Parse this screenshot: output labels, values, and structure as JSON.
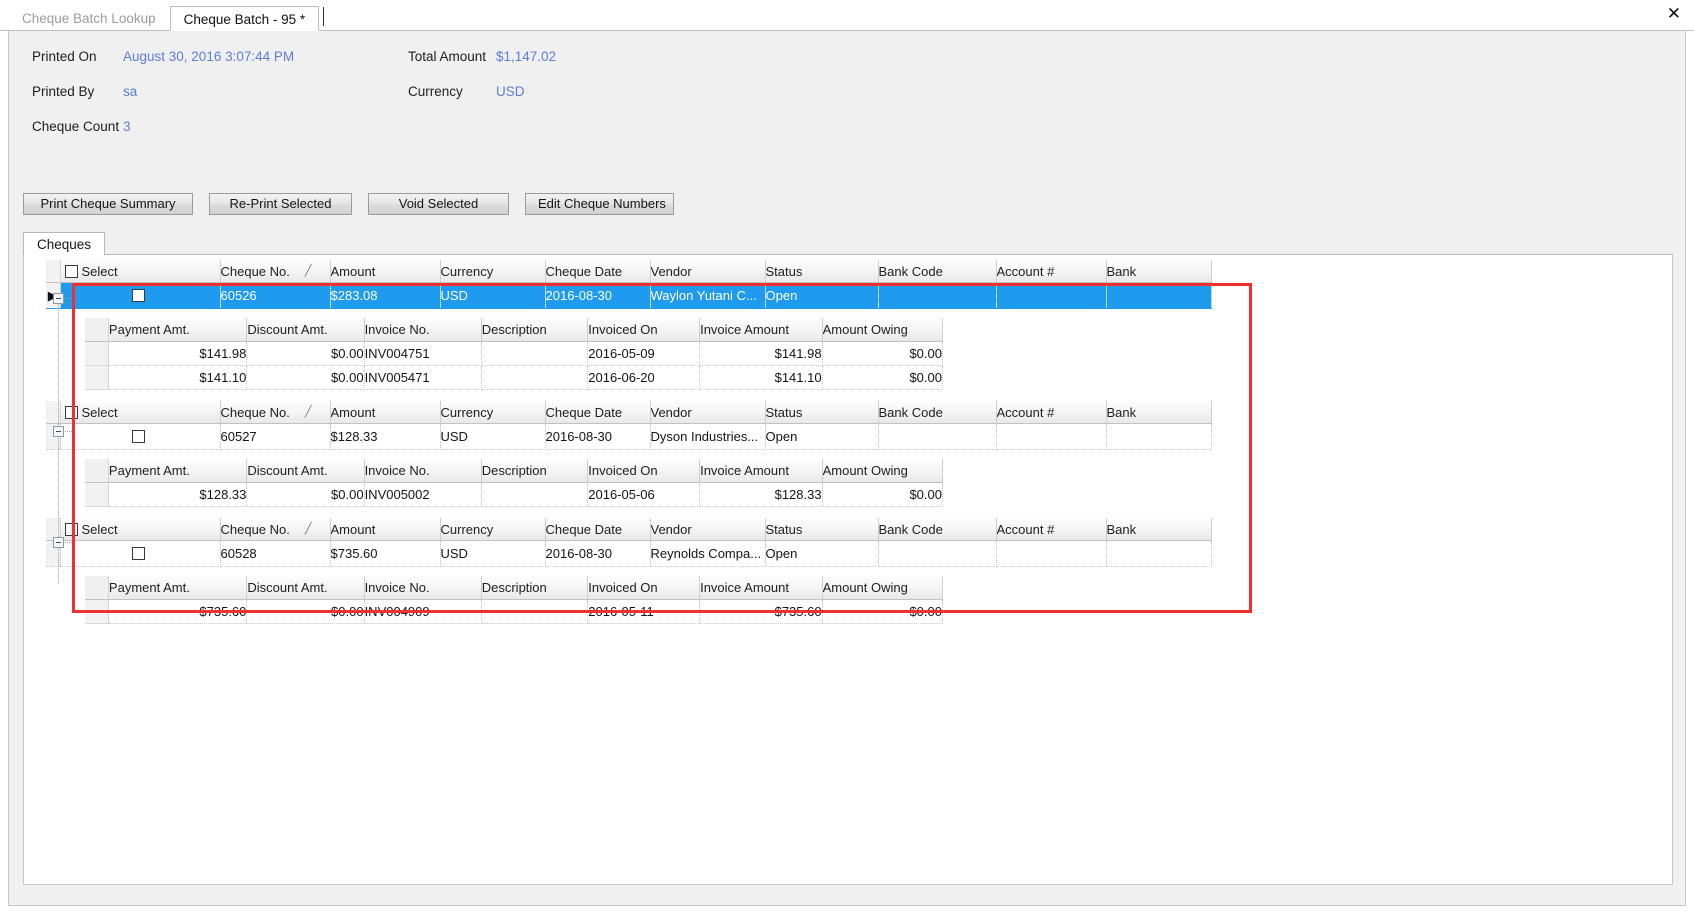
{
  "window": {
    "close_label": "✕",
    "tabs": [
      {
        "label": "Cheque Batch Lookup",
        "active": false
      },
      {
        "label": "Cheque Batch - 95 *",
        "active": true
      }
    ]
  },
  "summary": {
    "printed_on_label": "Printed On",
    "printed_on_value": "August 30, 2016 3:07:44 PM",
    "printed_by_label": "Printed By",
    "printed_by_value": "sa",
    "cheque_count_label": "Cheque Count",
    "cheque_count_value": "3",
    "total_amount_label": "Total Amount",
    "total_amount_value": "$1,147.02",
    "currency_label": "Currency",
    "currency_value": "USD"
  },
  "toolbar": {
    "print_cheque_summary": "Print Cheque Summary",
    "re_print_selected": "Re-Print Selected",
    "void_selected": "Void Selected",
    "edit_cheque_numbers": "Edit Cheque Numbers"
  },
  "inner_tabs": [
    {
      "label": "Cheques",
      "active": true
    }
  ],
  "grid": {
    "columns": [
      "Select",
      "Cheque No.",
      "Amount",
      "Currency",
      "Cheque Date",
      "Vendor",
      "Status",
      "Bank Code",
      "Account #",
      "Bank"
    ],
    "sort_indicator": "╱",
    "detail_columns": [
      "Payment Amt.",
      "Discount Amt.",
      "Invoice No.",
      "Description",
      "Invoiced On",
      "Invoice Amount",
      "Amount Owing"
    ],
    "groups": [
      {
        "selected": true,
        "row_indicator": "▶",
        "cheque_no": "60526",
        "amount": "$283.08",
        "currency": "USD",
        "cheque_date": "2016-08-30",
        "vendor": "Waylon Yutani C...",
        "status": "Open",
        "bank_code": "",
        "account_no": "",
        "bank": "",
        "details": [
          {
            "payment_amt": "$141.98",
            "discount_amt": "$0.00",
            "invoice_no": "INV004751",
            "description": "",
            "invoiced_on": "2016-05-09",
            "invoice_amount": "$141.98",
            "amount_owing": "$0.00"
          },
          {
            "payment_amt": "$141.10",
            "discount_amt": "$0.00",
            "invoice_no": "INV005471",
            "description": "",
            "invoiced_on": "2016-06-20",
            "invoice_amount": "$141.10",
            "amount_owing": "$0.00"
          }
        ]
      },
      {
        "selected": false,
        "row_indicator": "",
        "cheque_no": "60527",
        "amount": "$128.33",
        "currency": "USD",
        "cheque_date": "2016-08-30",
        "vendor": "Dyson Industries...",
        "status": "Open",
        "bank_code": "",
        "account_no": "",
        "bank": "",
        "details": [
          {
            "payment_amt": "$128.33",
            "discount_amt": "$0.00",
            "invoice_no": "INV005002",
            "description": "",
            "invoiced_on": "2016-05-06",
            "invoice_amount": "$128.33",
            "amount_owing": "$0.00"
          }
        ]
      },
      {
        "selected": false,
        "row_indicator": "",
        "cheque_no": "60528",
        "amount": "$735.60",
        "currency": "USD",
        "cheque_date": "2016-08-30",
        "vendor": "Reynolds Compa...",
        "status": "Open",
        "bank_code": "",
        "account_no": "",
        "bank": "",
        "details": [
          {
            "payment_amt": "$735.60",
            "discount_amt": "$0.00",
            "invoice_no": "INV004909",
            "description": "",
            "invoiced_on": "2016-05-11",
            "invoice_amount": "$735.60",
            "amount_owing": "$0.00"
          }
        ]
      }
    ]
  },
  "colors": {
    "link": "#5a7fd4",
    "selection": "#1e9aef",
    "highlight_border": "#f03030",
    "panel": "#f0f0f0"
  }
}
